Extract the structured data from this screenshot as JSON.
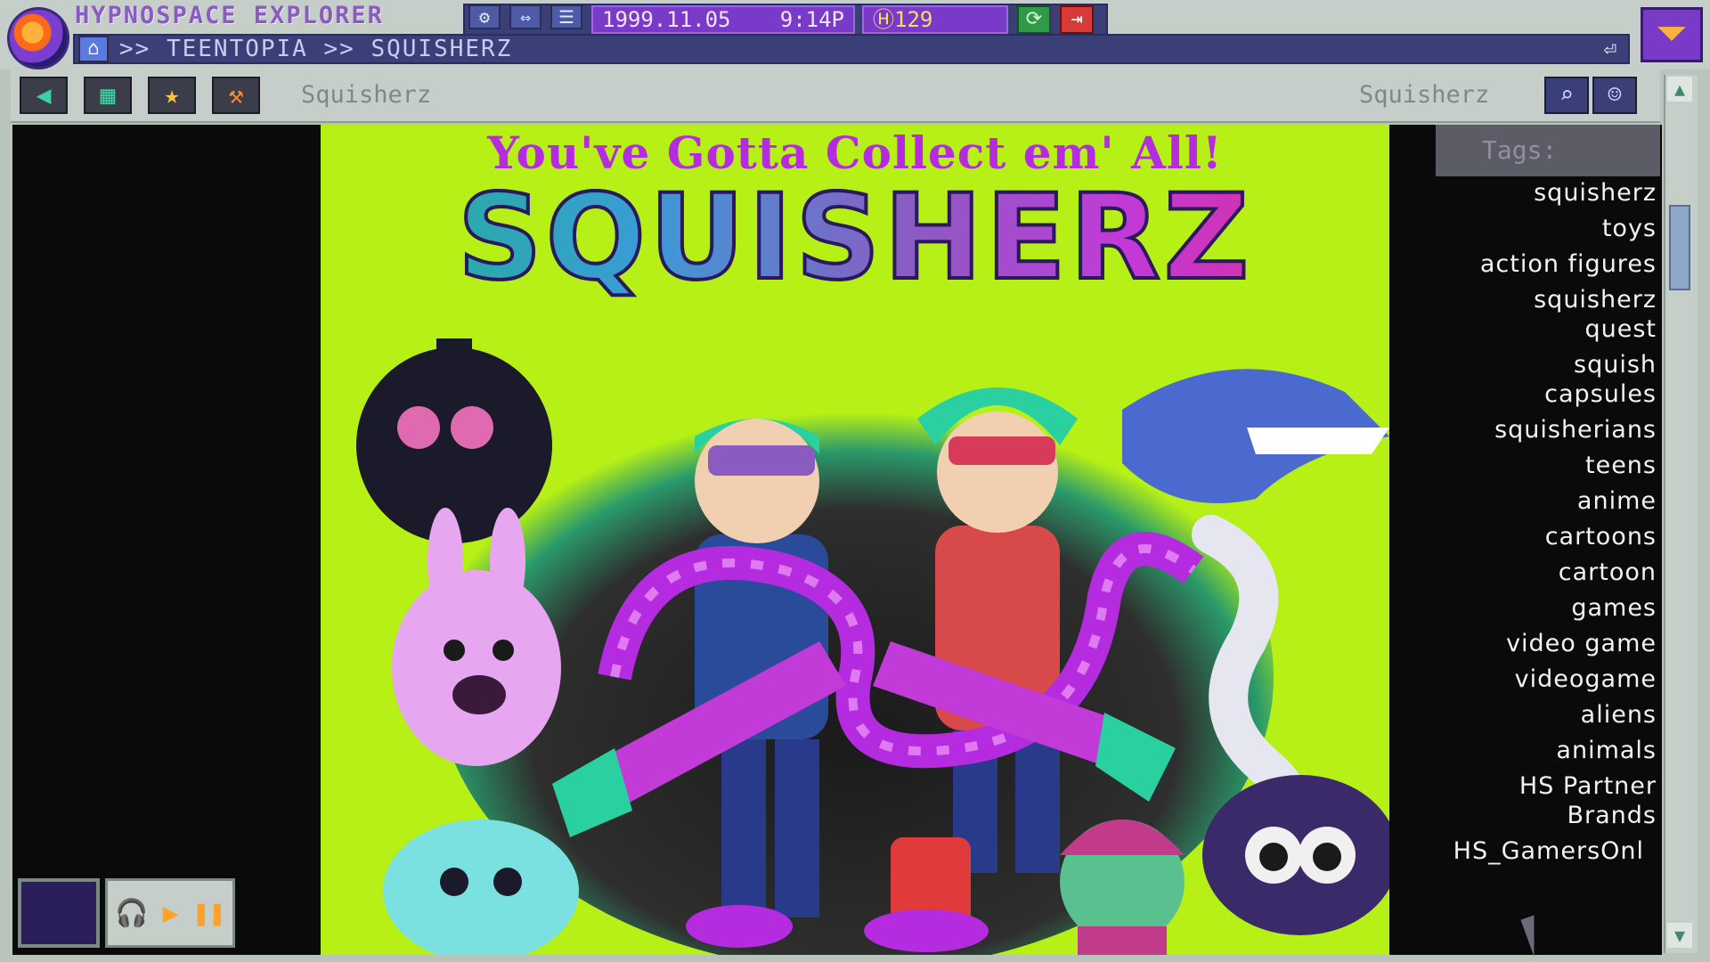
{
  "app": {
    "title": "HYPNOSPACE EXPLORER",
    "date": "1999.11.05",
    "time": "9:14P",
    "hypnocoins": "Ⓗ129"
  },
  "breadcrumb": ">> TEENTOPIA >> SQUISHERZ",
  "toolbar": {
    "page_title_left": "Squisherz",
    "page_title_right": "Squisherz"
  },
  "hero": {
    "tagline": "You've Gotta Collect em' All!",
    "logo": "SQUISHERZ"
  },
  "tags": {
    "header": "Tags:",
    "items": [
      "squisherz",
      "toys",
      "action figures",
      "squisherz quest",
      "squish capsules",
      "squisherians",
      "teens",
      "anime",
      "cartoons",
      "cartoon",
      "games",
      "video game",
      "videogame",
      "aliens",
      "animals",
      "HS Partner Brands",
      "HS_GamersOnl"
    ]
  },
  "icons": {
    "back": "back-arrow-icon",
    "home": "home-icon",
    "favorite": "star-icon",
    "search": "search-icon"
  }
}
